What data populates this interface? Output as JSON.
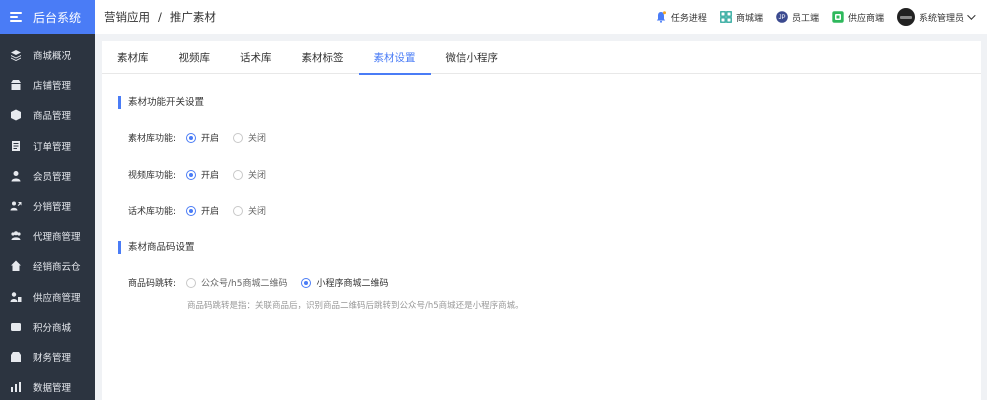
{
  "sidebar": {
    "brand": "后台系统",
    "items": [
      {
        "label": "商城概况",
        "icon": "layers-icon"
      },
      {
        "label": "店铺管理",
        "icon": "store-icon"
      },
      {
        "label": "商品管理",
        "icon": "box-icon"
      },
      {
        "label": "订单管理",
        "icon": "order-icon"
      },
      {
        "label": "会员管理",
        "icon": "member-icon"
      },
      {
        "label": "分销管理",
        "icon": "distribution-icon"
      },
      {
        "label": "代理商管理",
        "icon": "agent-icon"
      },
      {
        "label": "经销商云仓",
        "icon": "warehouse-icon"
      },
      {
        "label": "供应商管理",
        "icon": "supplier-icon"
      },
      {
        "label": "积分商城",
        "icon": "points-icon"
      },
      {
        "label": "财务管理",
        "icon": "finance-icon"
      },
      {
        "label": "数据管理",
        "icon": "chart-icon"
      }
    ]
  },
  "header": {
    "breadcrumb": [
      "营销应用",
      "推广素材"
    ],
    "separator": "/",
    "actions": [
      {
        "label": "任务进程",
        "icon": "bell-icon"
      },
      {
        "label": "商城端",
        "icon": "mall-icon"
      },
      {
        "label": "员工端",
        "icon": "staff-icon"
      },
      {
        "label": "供应商端",
        "icon": "supplier-portal-icon"
      }
    ],
    "user": "系统管理员"
  },
  "tabs": [
    {
      "label": "素材库",
      "active": false
    },
    {
      "label": "视频库",
      "active": false
    },
    {
      "label": "话术库",
      "active": false
    },
    {
      "label": "素材标签",
      "active": false
    },
    {
      "label": "素材设置",
      "active": true
    },
    {
      "label": "微信小程序",
      "active": false
    }
  ],
  "section1": {
    "title": "素材功能开关设置",
    "rows": [
      {
        "label": "素材库功能:",
        "options": [
          "开启",
          "关闭"
        ],
        "selected": 0
      },
      {
        "label": "视频库功能:",
        "options": [
          "开启",
          "关闭"
        ],
        "selected": 0
      },
      {
        "label": "话术库功能:",
        "options": [
          "开启",
          "关闭"
        ],
        "selected": 0
      }
    ]
  },
  "section2": {
    "title": "素材商品码设置",
    "row": {
      "label": "商品码跳转:",
      "options": [
        "公众号/h5商城二维码",
        "小程序商城二维码"
      ],
      "selected": 1
    },
    "hint": "商品码跳转是指：关联商品后，识别商品二维码后跳转到公众号/h5商城还是小程序商城。"
  },
  "colors": {
    "accent": "#4a7cf6",
    "sidebar_bg": "#2c3440"
  }
}
